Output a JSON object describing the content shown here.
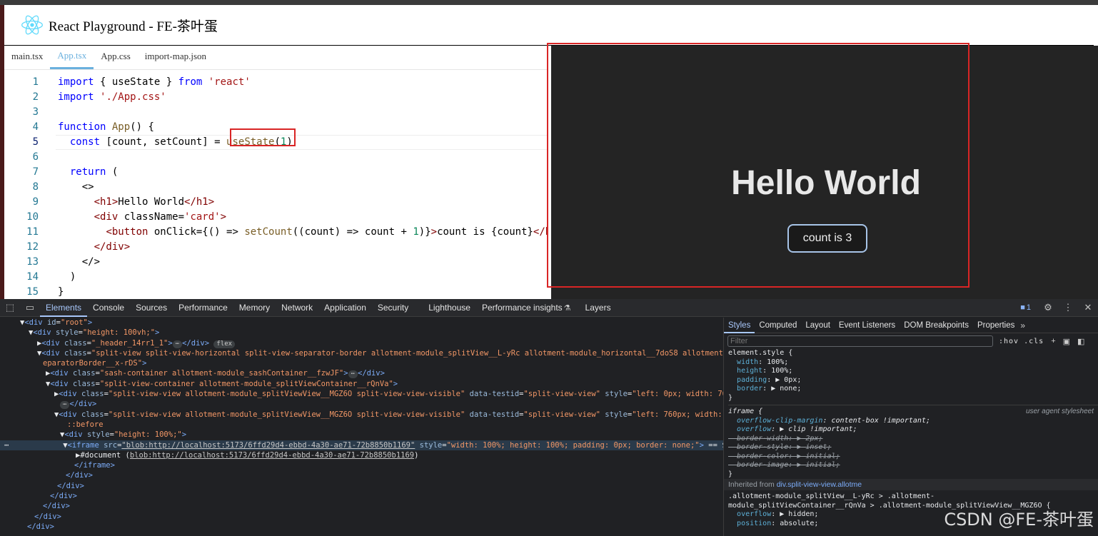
{
  "app": {
    "title": "React Playground - FE-茶叶蛋"
  },
  "editor": {
    "tabs": [
      "main.tsx",
      "App.tsx",
      "App.css",
      "import-map.json"
    ],
    "active_tab": "App.tsx"
  },
  "preview": {
    "heading": "Hello World",
    "button_label": "count is 3"
  },
  "devtools": {
    "tabs": [
      "Elements",
      "Console",
      "Sources",
      "Performance",
      "Memory",
      "Network",
      "Application",
      "Security",
      "Lighthouse",
      "Performance insights",
      "Layers"
    ],
    "active_tab": "Elements",
    "issues_badge": "1",
    "styles_tabs": [
      "Styles",
      "Computed",
      "Layout",
      "Event Listeners",
      "DOM Breakpoints",
      "Properties"
    ],
    "filter_placeholder": "Filter",
    "filter_tools": ":hov .cls",
    "inherited_from_label": "Inherited from",
    "inherited_from_selector": "div.split-view-view.allotme",
    "user_agent_label": "user agent stylesheet"
  },
  "watermark": "CSDN @FE-茶叶蛋",
  "colors": {
    "accent": "#6ab0de",
    "highlight": "#d92525",
    "preview_bg": "#242424"
  }
}
